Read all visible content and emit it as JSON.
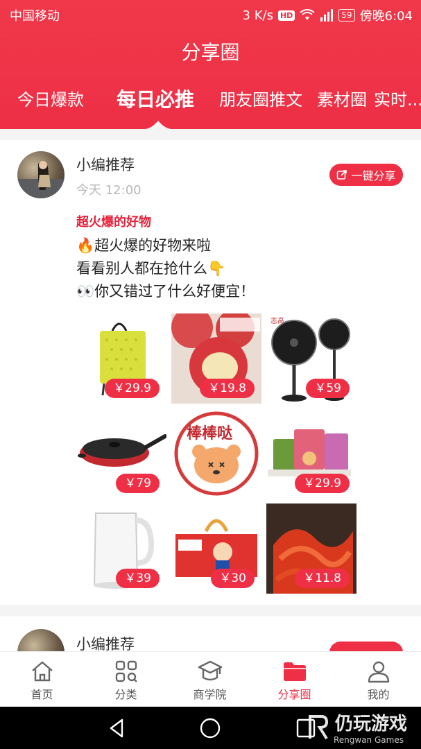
{
  "status": {
    "carrier": "中国移动",
    "speed": "3 K/s",
    "hd": "HD",
    "battery": "59",
    "time": "傍晚6:04"
  },
  "header": {
    "title": "分享圈",
    "tabs": [
      {
        "label": "今日爆款",
        "active": false
      },
      {
        "label": "每日必推",
        "active": true
      },
      {
        "label": "朋友圈推文",
        "active": false
      },
      {
        "label": "素材圈",
        "active": false
      },
      {
        "label": "实时...",
        "active": false
      }
    ]
  },
  "post": {
    "poster": "小编推荐",
    "time": "今天 12:00",
    "share_label": "一键分享",
    "tag": "超火爆的好物",
    "lines": [
      "🔥超火爆的好物来啦",
      "看看别人都在抢什么👇",
      "👀你又错过了什么好便宜！"
    ],
    "products": [
      {
        "name": "shopping-trolley-bag",
        "price": "￥29.9"
      },
      {
        "name": "apples",
        "price": "￥19.8"
      },
      {
        "name": "electric-fan",
        "price": "￥59"
      },
      {
        "name": "frying-pan",
        "price": "￥79"
      },
      {
        "name": "sticker-bear",
        "price": ""
      },
      {
        "name": "snack-bags",
        "price": "￥29.9"
      },
      {
        "name": "electric-kettle",
        "price": "￥39"
      },
      {
        "name": "wangzai-milk-box",
        "price": "￥30"
      },
      {
        "name": "spicy-noodles",
        "price": "￥11.8"
      }
    ],
    "sticker_text": "棒棒哒",
    "fan_brand": "志高"
  },
  "post2": {
    "poster": "小编推荐"
  },
  "nav": [
    {
      "label": "首页",
      "icon": "home-icon",
      "active": false
    },
    {
      "label": "分类",
      "icon": "category-icon",
      "active": false
    },
    {
      "label": "商学院",
      "icon": "academy-icon",
      "active": false
    },
    {
      "label": "分享圈",
      "icon": "folder-icon",
      "active": true
    },
    {
      "label": "我的",
      "icon": "user-icon",
      "active": false
    }
  ],
  "watermark": {
    "main": "仍玩游戏",
    "sub": "Rengwan Games"
  },
  "colors": {
    "accent": "#ee2f46",
    "tag": "#e8213a"
  }
}
